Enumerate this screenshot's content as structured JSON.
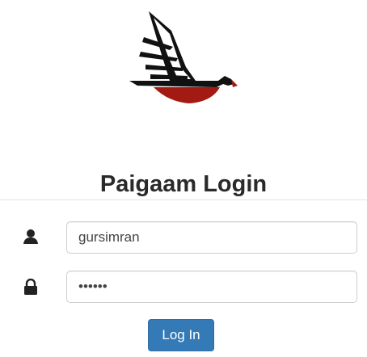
{
  "app": {
    "title": "Paigaam Login",
    "logo_icon": "hawk-logo-icon"
  },
  "form": {
    "username": {
      "icon": "user-icon",
      "value": "gursimran"
    },
    "password": {
      "icon": "lock-icon",
      "value": "gursim"
    },
    "submit_label": "Log In"
  },
  "colors": {
    "button": "#337ab7",
    "logo_red": "#a31a12",
    "text_dark": "#2a2a2a"
  }
}
